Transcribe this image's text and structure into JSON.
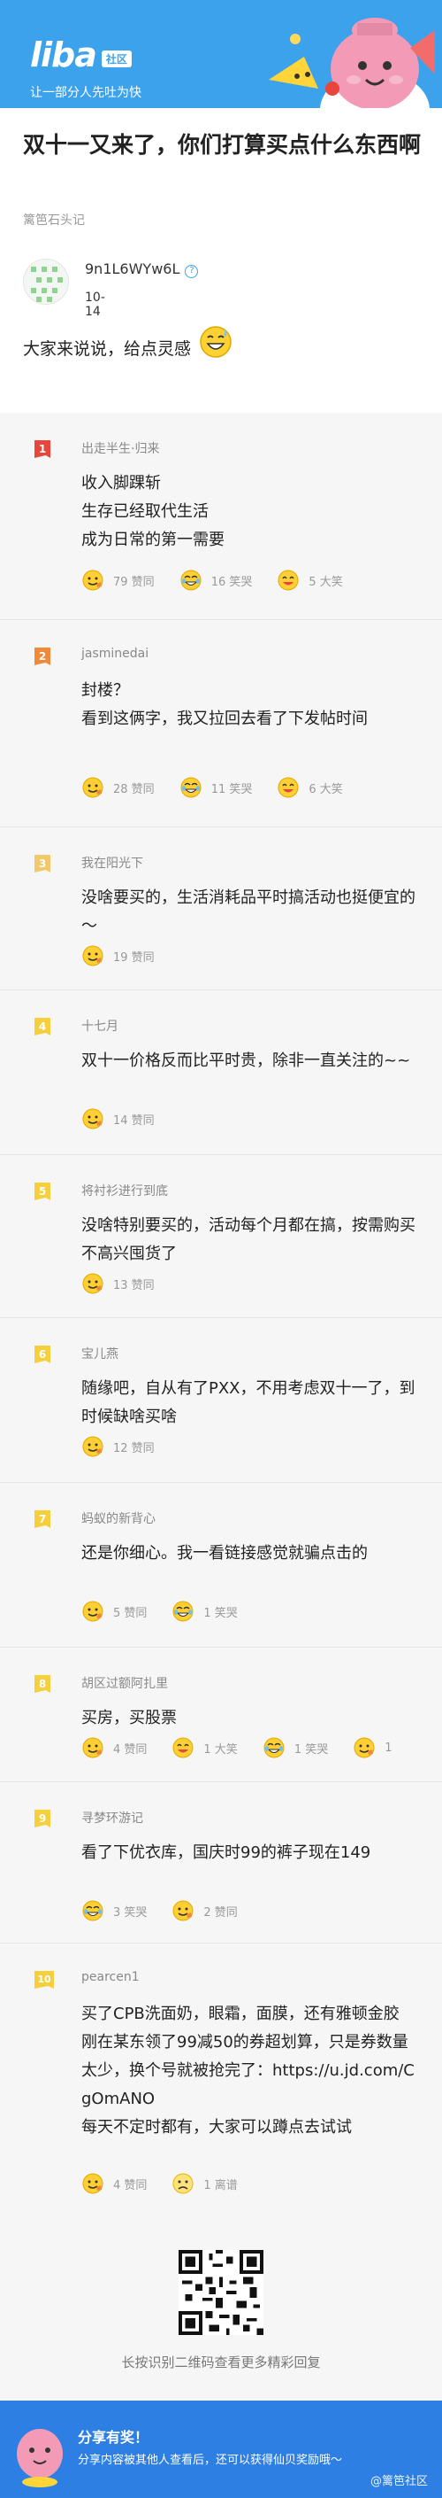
{
  "header": {
    "logo": "liba",
    "logo_badge": "社区",
    "slogan": "让一部分人先吐为快"
  },
  "article": {
    "title": "双十一又来了，你们打算买点什么东西啊",
    "source": "篱笆石头记",
    "author_name": "9n1L6WYw6L",
    "date": "10-14",
    "body": "大家来说说，给点灵感"
  },
  "comments": [
    {
      "rank": "1",
      "rank_color": "#e8453c",
      "author": "出走半生·归来",
      "text": "收入脚踝斩\n生存已经取代生活\n成为日常的第一需要",
      "reactions": [
        {
          "type": "like",
          "label": "79 赞同"
        },
        {
          "type": "laugh",
          "label": "16 笑哭"
        },
        {
          "type": "smile",
          "label": "5 大笑"
        }
      ]
    },
    {
      "rank": "2",
      "rank_color": "#f08a3a",
      "author": "jasminedai",
      "text": "封楼？\n看到这俩字，我又拉回去看了下发帖时间",
      "reactions": [
        {
          "type": "like",
          "label": "28 赞同"
        },
        {
          "type": "laugh",
          "label": "11 笑哭"
        },
        {
          "type": "smile",
          "label": "6 大笑"
        }
      ]
    },
    {
      "rank": "3",
      "rank_color": "#f2c86a",
      "author": "我在阳光下",
      "text": "没啥要买的，生活消耗品平时搞活动也挺便宜的～",
      "reactions": [
        {
          "type": "like",
          "label": "19 赞同"
        }
      ]
    },
    {
      "rank": "4",
      "rank_color": "#f5cf3c",
      "author": "十七月",
      "text": "双十一价格反而比平时贵，除非一直关注的~~",
      "reactions": [
        {
          "type": "like",
          "label": "14 赞同"
        }
      ]
    },
    {
      "rank": "5",
      "rank_color": "#f5cf3c",
      "author": "将衬衫进行到底",
      "text": "没啥特别要买的，活动每个月都在搞，按需购买不高兴囤货了",
      "reactions": [
        {
          "type": "like",
          "label": "13 赞同"
        }
      ]
    },
    {
      "rank": "6",
      "rank_color": "#f5cf3c",
      "author": "宝儿燕",
      "text": "随缘吧，自从有了PXX，不用考虑双十一了，到时候缺啥买啥",
      "reactions": [
        {
          "type": "like",
          "label": "12 赞同"
        }
      ]
    },
    {
      "rank": "7",
      "rank_color": "#f5cf3c",
      "author": "蚂蚁的新背心",
      "text": "还是你细心。我一看链接感觉就骗点击的",
      "reactions": [
        {
          "type": "like",
          "label": "5 赞同"
        },
        {
          "type": "laugh",
          "label": "1 笑哭"
        }
      ]
    },
    {
      "rank": "8",
      "rank_color": "#f5cf3c",
      "author": "胡区过额阿扎里",
      "text": "买房，买股票",
      "reactions": [
        {
          "type": "like",
          "label": "4 赞同"
        },
        {
          "type": "smile",
          "label": "1 大笑"
        },
        {
          "type": "laugh",
          "label": "1 笑哭"
        },
        {
          "type": "like",
          "label": "1"
        }
      ]
    },
    {
      "rank": "9",
      "rank_color": "#f5cf3c",
      "author": "寻梦环游记",
      "text": "看了下优衣库，国庆时99的裤子现在149",
      "reactions": [
        {
          "type": "laugh",
          "label": "3 笑哭"
        },
        {
          "type": "like",
          "label": "2 赞同"
        }
      ]
    },
    {
      "rank": "10",
      "rank_color": "#f5cf3c",
      "author": "pearcen1",
      "text": "买了CPB洗面奶，眼霜，面膜，还有雅顿金胶\n刚在某东领了99减50的券超划算，只是券数量太少，换个号就被抢完了：https://u.jd.com/CgOmANO\n每天不定时都有，大家可以蹲点去试试",
      "reactions": [
        {
          "type": "like",
          "label": "4 赞同"
        },
        {
          "type": "sad",
          "label": "1 离谱"
        }
      ]
    }
  ],
  "qr": {
    "caption": "长按识别二维码查看更多精彩回复"
  },
  "footer": {
    "title": "分享有奖！",
    "text": "分享内容被其他人查看后，还可以获得仙贝奖励哦～",
    "watermark": "@篱笆社区"
  }
}
